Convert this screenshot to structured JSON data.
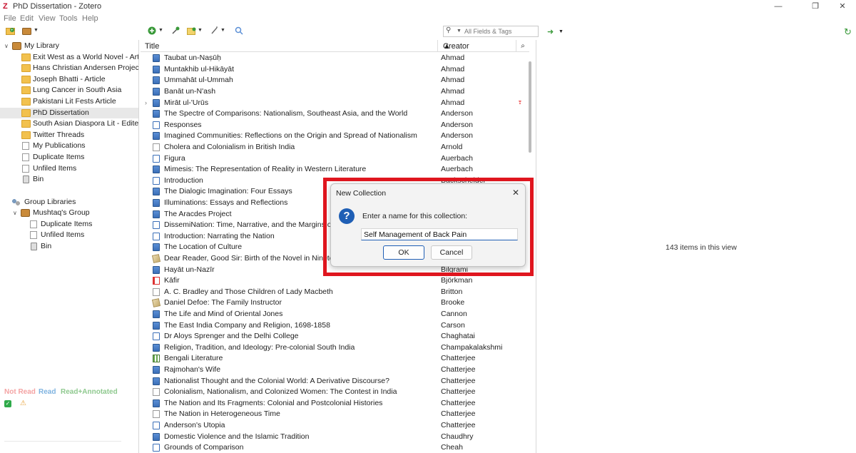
{
  "window": {
    "title": "PhD Dissertation - Zotero",
    "app_icon": "Z",
    "minimize": "—",
    "maximize": "❐",
    "close": "✕"
  },
  "menu": [
    "File",
    "Edit",
    "View",
    "Tools",
    "Help"
  ],
  "search": {
    "placeholder": "All Fields & Tags"
  },
  "left_pane": {
    "my_library": "My Library",
    "collections": [
      "Exit West as a World Novel - Artic...",
      "Hans Christian Andersen Project",
      "Joseph Bhatti - Article",
      "Lung Cancer in South Asia",
      "Pakistani Lit Fests Article",
      "PhD Dissertation",
      "South Asian Diaspora Lit - Edited...",
      "Twitter Threads"
    ],
    "selected_collection": "PhD Dissertation",
    "special": [
      "My Publications",
      "Duplicate Items",
      "Unfiled Items",
      "Bin"
    ],
    "group_libraries": "Group Libraries",
    "group": "Mushtaq's Group",
    "group_items": [
      "Duplicate Items",
      "Unfiled Items",
      "Bin"
    ],
    "tag_filters": {
      "not_read": "Not Read",
      "read": "Read",
      "read_annotated": "Read+Annotated",
      "not_read_color": "#f4a3a3",
      "read_color": "#7fb3e0",
      "read_annotated_color": "#8fc98f"
    }
  },
  "columns": {
    "title": "Title",
    "creator": "Creator"
  },
  "items": [
    {
      "title": "Taubat un-Naṣūḥ",
      "creator": "Ahmad",
      "icon": "book"
    },
    {
      "title": "Muntakhib ul-Hikāyāt",
      "creator": "Ahmad",
      "icon": "book"
    },
    {
      "title": "Ummahāt ul-Ummah",
      "creator": "Ahmad",
      "icon": "book"
    },
    {
      "title": "Banāt un-N'ash",
      "creator": "Ahmad",
      "icon": "book"
    },
    {
      "title": "Mirāt ul-'Urūs",
      "creator": "Ahmad",
      "icon": "book",
      "expander": true,
      "flag": true
    },
    {
      "title": "The Spectre of Comparisons: Nationalism, Southeast Asia, and the World",
      "creator": "Anderson",
      "icon": "book"
    },
    {
      "title": "Responses",
      "creator": "Anderson",
      "icon": "section"
    },
    {
      "title": "Imagined Communities: Reflections on the Origin and Spread of Nationalism",
      "creator": "Anderson",
      "icon": "book"
    },
    {
      "title": "Cholera and Colonialism in British India",
      "creator": "Arnold",
      "icon": "journal"
    },
    {
      "title": "Figura",
      "creator": "Auerbach",
      "icon": "section"
    },
    {
      "title": "Mimesis: The Representation of Reality in Western Literature",
      "creator": "Auerbach",
      "icon": "book"
    },
    {
      "title": "Introduction",
      "creator": "Backscheider",
      "icon": "section"
    },
    {
      "title": "The Dialogic Imagination: Four Essays",
      "creator": "",
      "icon": "book"
    },
    {
      "title": "Illuminations: Essays and Reflections",
      "creator": "",
      "icon": "book"
    },
    {
      "title": "The Aracdes Project",
      "creator": "",
      "icon": "book"
    },
    {
      "title": "DissemiNation: Time, Narrative, and the Margins of the M",
      "creator": "",
      "icon": "section"
    },
    {
      "title": "Introduction: Narrating the Nation",
      "creator": "",
      "icon": "section"
    },
    {
      "title": "The Location of Culture",
      "creator": "",
      "icon": "book"
    },
    {
      "title": "Dear Reader, Good Sir: Birth of the Novel in Nineteent",
      "creator": "",
      "icon": "manuscript"
    },
    {
      "title": "Hayāt un-Nazīr",
      "creator": "Bilgrami",
      "icon": "book"
    },
    {
      "title": "Kāfir",
      "creator": "Björkman",
      "icon": "thesis"
    },
    {
      "title": "A. C. Bradley and Those Children of Lady Macbeth",
      "creator": "Britton",
      "icon": "journal"
    },
    {
      "title": "Daniel Defoe: The Family Instructor",
      "creator": "Brooke",
      "icon": "manuscript"
    },
    {
      "title": "The Life and Mind of Oriental Jones",
      "creator": "Cannon",
      "icon": "book"
    },
    {
      "title": "The East India Company and Religion, 1698-1858",
      "creator": "Carson",
      "icon": "book"
    },
    {
      "title": "Dr Aloys Sprenger and the Delhi College",
      "creator": "Chaghatai",
      "icon": "section"
    },
    {
      "title": "Religion, Tradition, and Ideology: Pre-colonial South India",
      "creator": "Champakalakshmi",
      "icon": "book"
    },
    {
      "title": "Bengali Literature",
      "creator": "Chatterjee",
      "icon": "dataset"
    },
    {
      "title": "Rajmohan's Wife",
      "creator": "Chatterjee",
      "icon": "book"
    },
    {
      "title": "Nationalist Thought and the Colonial World: A Derivative Discourse?",
      "creator": "Chatterjee",
      "icon": "book"
    },
    {
      "title": "Colonialism, Nationalism, and Colonized Women: The Contest in India",
      "creator": "Chatterjee",
      "icon": "journal"
    },
    {
      "title": "The Nation and Its Fragments: Colonial and Postcolonial Histories",
      "creator": "Chatterjee",
      "icon": "book"
    },
    {
      "title": "The Nation in Heterogeneous Time",
      "creator": "Chatterjee",
      "icon": "journal"
    },
    {
      "title": "Anderson's Utopia",
      "creator": "Chatterjee",
      "icon": "section"
    },
    {
      "title": "Domestic Violence and the Islamic Tradition",
      "creator": "Chaudhry",
      "icon": "book"
    },
    {
      "title": "Grounds of Comparison",
      "creator": "Cheah",
      "icon": "section"
    }
  ],
  "right_pane": {
    "count": "143 items in this view"
  },
  "dialog": {
    "title": "New Collection",
    "prompt": "Enter a name for this collection:",
    "value": "Self Management of Back Pain",
    "ok": "OK",
    "cancel": "Cancel",
    "close": "✕",
    "question_mark": "?"
  },
  "highlight_color": "#e0161f"
}
